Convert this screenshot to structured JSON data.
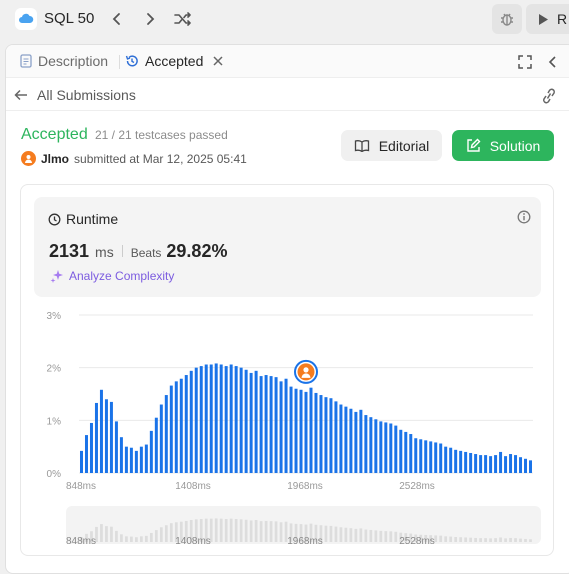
{
  "topbar": {
    "title": "SQL 50",
    "run_label": "R"
  },
  "tabs": {
    "description": "Description",
    "accepted": "Accepted"
  },
  "subhead": {
    "back_label": "All Submissions"
  },
  "result": {
    "status": "Accepted",
    "testcases": "21 / 21 testcases passed",
    "author": "Jlmo",
    "submitted_text": "submitted at Mar 12, 2025 05:41",
    "editorial_label": "Editorial",
    "solution_label": "Solution"
  },
  "runtime": {
    "title": "Runtime",
    "value": "2131",
    "unit": "ms",
    "beats_label": "Beats",
    "beats_value": "29.82%",
    "analyze_label": "Analyze Complexity"
  },
  "colors": {
    "accent_green": "#2db55d",
    "bar_blue": "#1a73e8",
    "marker_orange": "#f57c1f",
    "analyze_purple": "#7c5ce0"
  },
  "chart_data": {
    "type": "bar",
    "xlabel": "",
    "ylabel": "",
    "yticks": [
      "0%",
      "1%",
      "2%",
      "3%"
    ],
    "ylim": [
      0,
      3
    ],
    "xticks": [
      "848ms",
      "1408ms",
      "1968ms",
      "2528ms"
    ],
    "grid": true,
    "values": [
      0.42,
      0.72,
      0.95,
      1.33,
      1.58,
      1.4,
      1.35,
      0.98,
      0.68,
      0.5,
      0.48,
      0.42,
      0.5,
      0.54,
      0.8,
      1.05,
      1.3,
      1.48,
      1.66,
      1.74,
      1.79,
      1.86,
      1.94,
      2.0,
      2.03,
      2.06,
      2.06,
      2.08,
      2.06,
      2.03,
      2.06,
      2.03,
      2.0,
      1.96,
      1.9,
      1.94,
      1.84,
      1.86,
      1.84,
      1.82,
      1.74,
      1.79,
      1.64,
      1.6,
      1.58,
      1.54,
      1.62,
      1.52,
      1.48,
      1.44,
      1.42,
      1.36,
      1.3,
      1.26,
      1.22,
      1.16,
      1.2,
      1.1,
      1.06,
      1.02,
      0.98,
      0.96,
      0.94,
      0.9,
      0.82,
      0.78,
      0.74,
      0.66,
      0.64,
      0.62,
      0.6,
      0.58,
      0.56,
      0.5,
      0.48,
      0.44,
      0.42,
      0.4,
      0.38,
      0.36,
      0.34,
      0.34,
      0.32,
      0.34,
      0.4,
      0.32,
      0.36,
      0.34,
      0.3,
      0.27,
      0.24
    ],
    "marker_index": 45
  }
}
